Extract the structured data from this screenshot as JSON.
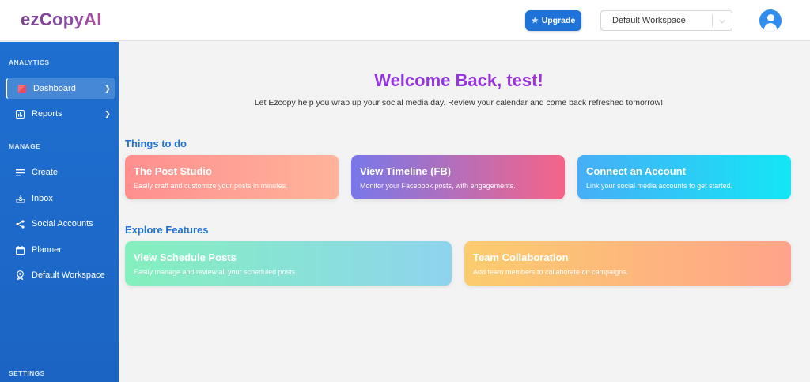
{
  "header": {
    "logo": "ezCopyAI",
    "upgrade_label": "Upgrade",
    "workspace_value": "Default Workspace"
  },
  "sidebar": {
    "sections": {
      "analytics": "ANALYTICS",
      "manage": "MANAGE",
      "settings": "SETTINGS"
    },
    "items": [
      {
        "label": "Dashboard",
        "icon": "dashboard-icon",
        "active": true,
        "expandable": true
      },
      {
        "label": "Reports",
        "icon": "bar-chart-icon",
        "active": false,
        "expandable": true
      },
      {
        "label": "Create",
        "icon": "list-icon",
        "active": false,
        "expandable": false
      },
      {
        "label": "Inbox",
        "icon": "inbox-icon",
        "active": false,
        "expandable": false
      },
      {
        "label": "Social Accounts",
        "icon": "share-icon",
        "active": false,
        "expandable": false
      },
      {
        "label": "Planner",
        "icon": "calendar-icon",
        "active": false,
        "expandable": false
      },
      {
        "label": "Default Workspace",
        "icon": "badge-icon",
        "active": false,
        "expandable": false
      }
    ]
  },
  "main": {
    "welcome": "Welcome Back, test!",
    "subtitle": "Let Ezcopy help you wrap up your social media day. Review your calendar and come back refreshed tomorrow!",
    "things_to_do": {
      "title": "Things to do",
      "cards": [
        {
          "title": "The Post Studio",
          "desc": "Easily craft and customize your posts in minutes."
        },
        {
          "title": "View Timeline (FB)",
          "desc": "Monitor your Facebook posts, with engagements."
        },
        {
          "title": "Connect an Account",
          "desc": "Link your social media accounts to get started."
        }
      ]
    },
    "explore": {
      "title": "Explore Features",
      "cards": [
        {
          "title": "View Schedule Posts",
          "desc": "Easily manage and review all your scheduled posts."
        },
        {
          "title": "Team Collaboration",
          "desc": "Add team members to collaborate on campaigns."
        }
      ]
    }
  },
  "colors": {
    "primary": "#1f73d8",
    "sidebar": "#1e6fd0",
    "welcome": "#8a39e6"
  }
}
